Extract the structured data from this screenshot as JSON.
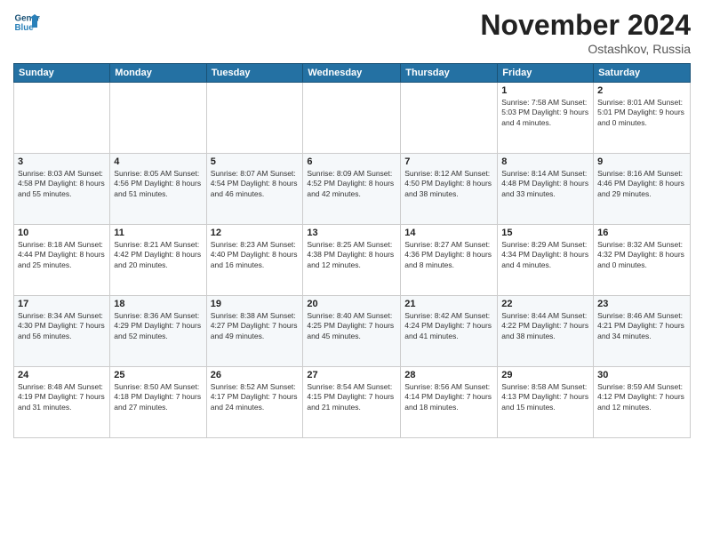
{
  "logo": {
    "line1": "General",
    "line2": "Blue"
  },
  "title": "November 2024",
  "location": "Ostashkov, Russia",
  "days_header": [
    "Sunday",
    "Monday",
    "Tuesday",
    "Wednesday",
    "Thursday",
    "Friday",
    "Saturday"
  ],
  "weeks": [
    [
      {
        "day": "",
        "info": ""
      },
      {
        "day": "",
        "info": ""
      },
      {
        "day": "",
        "info": ""
      },
      {
        "day": "",
        "info": ""
      },
      {
        "day": "",
        "info": ""
      },
      {
        "day": "1",
        "info": "Sunrise: 7:58 AM\nSunset: 5:03 PM\nDaylight: 9 hours\nand 4 minutes."
      },
      {
        "day": "2",
        "info": "Sunrise: 8:01 AM\nSunset: 5:01 PM\nDaylight: 9 hours\nand 0 minutes."
      }
    ],
    [
      {
        "day": "3",
        "info": "Sunrise: 8:03 AM\nSunset: 4:58 PM\nDaylight: 8 hours\nand 55 minutes."
      },
      {
        "day": "4",
        "info": "Sunrise: 8:05 AM\nSunset: 4:56 PM\nDaylight: 8 hours\nand 51 minutes."
      },
      {
        "day": "5",
        "info": "Sunrise: 8:07 AM\nSunset: 4:54 PM\nDaylight: 8 hours\nand 46 minutes."
      },
      {
        "day": "6",
        "info": "Sunrise: 8:09 AM\nSunset: 4:52 PM\nDaylight: 8 hours\nand 42 minutes."
      },
      {
        "day": "7",
        "info": "Sunrise: 8:12 AM\nSunset: 4:50 PM\nDaylight: 8 hours\nand 38 minutes."
      },
      {
        "day": "8",
        "info": "Sunrise: 8:14 AM\nSunset: 4:48 PM\nDaylight: 8 hours\nand 33 minutes."
      },
      {
        "day": "9",
        "info": "Sunrise: 8:16 AM\nSunset: 4:46 PM\nDaylight: 8 hours\nand 29 minutes."
      }
    ],
    [
      {
        "day": "10",
        "info": "Sunrise: 8:18 AM\nSunset: 4:44 PM\nDaylight: 8 hours\nand 25 minutes."
      },
      {
        "day": "11",
        "info": "Sunrise: 8:21 AM\nSunset: 4:42 PM\nDaylight: 8 hours\nand 20 minutes."
      },
      {
        "day": "12",
        "info": "Sunrise: 8:23 AM\nSunset: 4:40 PM\nDaylight: 8 hours\nand 16 minutes."
      },
      {
        "day": "13",
        "info": "Sunrise: 8:25 AM\nSunset: 4:38 PM\nDaylight: 8 hours\nand 12 minutes."
      },
      {
        "day": "14",
        "info": "Sunrise: 8:27 AM\nSunset: 4:36 PM\nDaylight: 8 hours\nand 8 minutes."
      },
      {
        "day": "15",
        "info": "Sunrise: 8:29 AM\nSunset: 4:34 PM\nDaylight: 8 hours\nand 4 minutes."
      },
      {
        "day": "16",
        "info": "Sunrise: 8:32 AM\nSunset: 4:32 PM\nDaylight: 8 hours\nand 0 minutes."
      }
    ],
    [
      {
        "day": "17",
        "info": "Sunrise: 8:34 AM\nSunset: 4:30 PM\nDaylight: 7 hours\nand 56 minutes."
      },
      {
        "day": "18",
        "info": "Sunrise: 8:36 AM\nSunset: 4:29 PM\nDaylight: 7 hours\nand 52 minutes."
      },
      {
        "day": "19",
        "info": "Sunrise: 8:38 AM\nSunset: 4:27 PM\nDaylight: 7 hours\nand 49 minutes."
      },
      {
        "day": "20",
        "info": "Sunrise: 8:40 AM\nSunset: 4:25 PM\nDaylight: 7 hours\nand 45 minutes."
      },
      {
        "day": "21",
        "info": "Sunrise: 8:42 AM\nSunset: 4:24 PM\nDaylight: 7 hours\nand 41 minutes."
      },
      {
        "day": "22",
        "info": "Sunrise: 8:44 AM\nSunset: 4:22 PM\nDaylight: 7 hours\nand 38 minutes."
      },
      {
        "day": "23",
        "info": "Sunrise: 8:46 AM\nSunset: 4:21 PM\nDaylight: 7 hours\nand 34 minutes."
      }
    ],
    [
      {
        "day": "24",
        "info": "Sunrise: 8:48 AM\nSunset: 4:19 PM\nDaylight: 7 hours\nand 31 minutes."
      },
      {
        "day": "25",
        "info": "Sunrise: 8:50 AM\nSunset: 4:18 PM\nDaylight: 7 hours\nand 27 minutes."
      },
      {
        "day": "26",
        "info": "Sunrise: 8:52 AM\nSunset: 4:17 PM\nDaylight: 7 hours\nand 24 minutes."
      },
      {
        "day": "27",
        "info": "Sunrise: 8:54 AM\nSunset: 4:15 PM\nDaylight: 7 hours\nand 21 minutes."
      },
      {
        "day": "28",
        "info": "Sunrise: 8:56 AM\nSunset: 4:14 PM\nDaylight: 7 hours\nand 18 minutes."
      },
      {
        "day": "29",
        "info": "Sunrise: 8:58 AM\nSunset: 4:13 PM\nDaylight: 7 hours\nand 15 minutes."
      },
      {
        "day": "30",
        "info": "Sunrise: 8:59 AM\nSunset: 4:12 PM\nDaylight: 7 hours\nand 12 minutes."
      }
    ]
  ]
}
